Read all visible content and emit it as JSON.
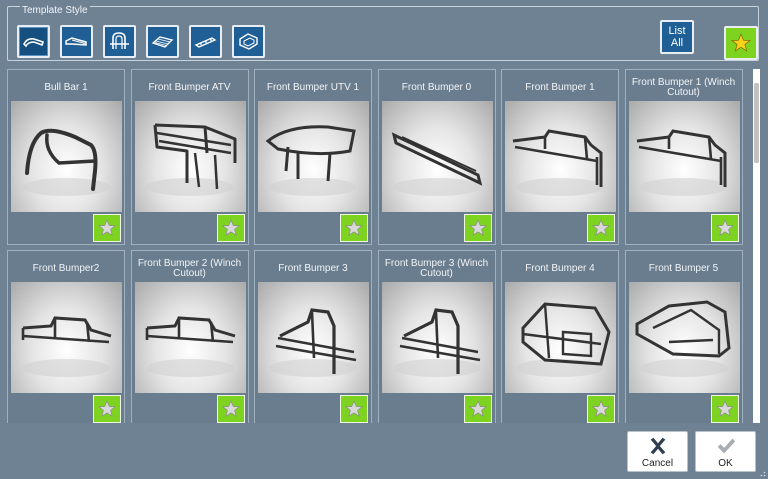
{
  "template_style": {
    "title": "Template Style",
    "buttons": [
      {
        "icon": "bumper-bar-icon"
      },
      {
        "icon": "bumper-plate-icon"
      },
      {
        "icon": "bull-bar-icon"
      },
      {
        "icon": "grille-icon"
      },
      {
        "icon": "bumper-rail-icon"
      },
      {
        "icon": "cage-bumper-icon"
      }
    ],
    "list_all_line1": "List",
    "list_all_line2": "All",
    "favorites_icon": "star-icon"
  },
  "items": [
    {
      "title": "Bull Bar 1",
      "shape": "bullbar"
    },
    {
      "title": "Front Bumper ATV",
      "shape": "atv"
    },
    {
      "title": "Front Bumper UTV 1",
      "shape": "utv"
    },
    {
      "title": "Front Bumper 0",
      "shape": "zero"
    },
    {
      "title": "Front Bumper 1",
      "shape": "one"
    },
    {
      "title": "Front Bumper 1 (Winch Cutout)",
      "shape": "one"
    },
    {
      "title": "Front Bumper2",
      "shape": "two"
    },
    {
      "title": "Front Bumper 2 (Winch Cutout)",
      "shape": "two"
    },
    {
      "title": "Front Bumper 3",
      "shape": "three"
    },
    {
      "title": "Front Bumper 3 (Winch Cutout)",
      "shape": "three"
    },
    {
      "title": "Front Bumper 4",
      "shape": "four"
    },
    {
      "title": "Front Bumper 5",
      "shape": "five"
    }
  ],
  "footer": {
    "cancel_label": "Cancel",
    "ok_label": "OK"
  },
  "colors": {
    "background": "#6f8294",
    "accent_blue": "#1f5f96",
    "favorite_green": "#7ed321"
  }
}
